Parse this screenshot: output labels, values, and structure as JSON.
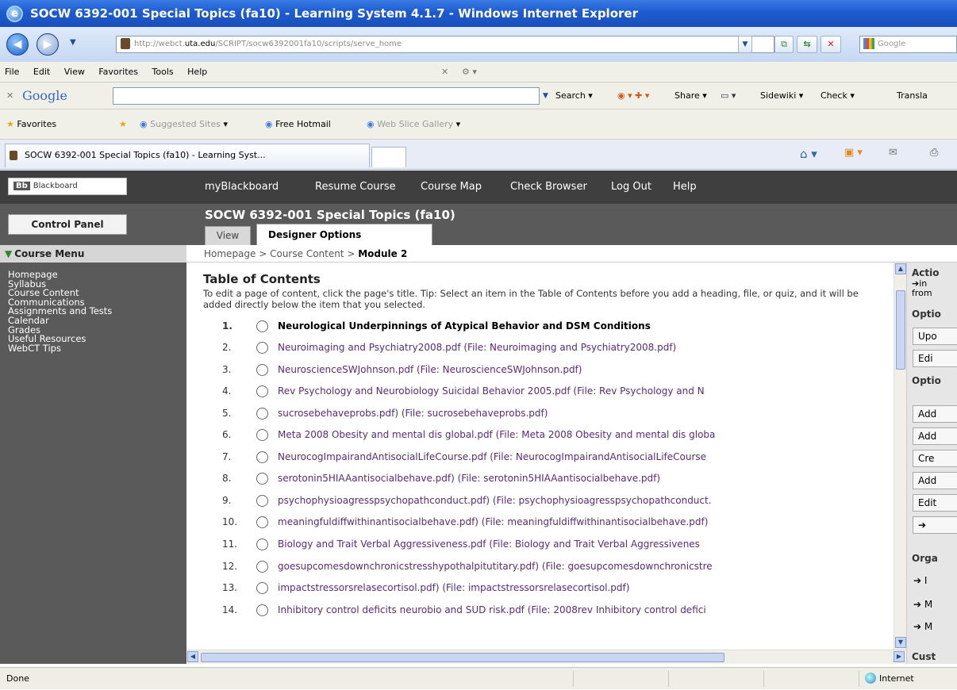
{
  "window": {
    "title": "SOCW 6392-001 Special Topics (fa10) - Learning System 4.1.7 - Windows Internet Explorer"
  },
  "address": {
    "host": "http://webct.",
    "domain": "uta.edu",
    "path": "/SCRIPT/socw6392001fa10/scripts/serve_home"
  },
  "search": {
    "placeholder": "Google"
  },
  "menu": [
    "File",
    "Edit",
    "View",
    "Favorites",
    "Tools",
    "Help"
  ],
  "google_toolbar": {
    "brand": "Google",
    "search": "Search",
    "share": "Share",
    "sidewiki": "Sidewiki",
    "check": "Check",
    "translate": "Transla"
  },
  "favorites_bar": {
    "favorites": "Favorites",
    "suggested": "Suggested Sites",
    "hotmail": "Free Hotmail",
    "webslice": "Web Slice Gallery"
  },
  "tab": {
    "label": "SOCW 6392-001 Special Topics (fa10) - Learning Syst..."
  },
  "bb": {
    "logo": "Blackboard",
    "nav": [
      "myBlackboard",
      "Resume Course",
      "Course Map",
      "Check Browser",
      "Log Out",
      "Help"
    ],
    "control_panel": "Control Panel",
    "course_title": "SOCW 6392-001 Special Topics (fa10)",
    "tab_view": "View",
    "tab_designer": "Designer Options",
    "course_menu": "Course Menu",
    "menu_items": [
      "Homepage",
      "Syllabus",
      "Course Content",
      "Communications",
      "Assignments and Tests",
      "Calendar",
      "Grades",
      "Useful Resources",
      "WebCT Tips"
    ]
  },
  "breadcrumb": {
    "home": "Homepage",
    "sep": " > ",
    "content": "Course Content",
    "current": "Module 2"
  },
  "toc": {
    "title": "Table of Contents",
    "description": "To edit a page of content, click the page's title. Tip: Select an item in the Table of Contents before you add a heading, file, or quiz, and it will be added directly below the item that you selected.",
    "items": [
      {
        "num": "1.",
        "text": "Neurological Underpinnings of Atypical Behavior and DSM Conditions"
      },
      {
        "num": "2.",
        "text": "Neuroimaging and Psychiatry2008.pdf  (File: Neuroimaging and Psychiatry2008.pdf)"
      },
      {
        "num": "3.",
        "text": "NeuroscienceSWJohnson.pdf  (File: NeuroscienceSWJohnson.pdf)"
      },
      {
        "num": "4.",
        "text": "Rev Psychology and Neurobiology Suicidal Behavior 2005.pdf  (File: Rev Psychology and N"
      },
      {
        "num": "5.",
        "text": "sucrosebehaveprobs.pdf)  (File: sucrosebehaveprobs.pdf)"
      },
      {
        "num": "6.",
        "text": "Meta 2008 Obesity and mental dis global.pdf  (File: Meta 2008 Obesity and mental dis globa"
      },
      {
        "num": "7.",
        "text": "NeurocogImpairandAntisocialLifeCourse.pdf  (File: NeurocogImpairandAntisocialLifeCourse"
      },
      {
        "num": "8.",
        "text": "serotonin5HIAAantisocialbehave.pdf)  (File: serotonin5HIAAantisocialbehave.pdf)"
      },
      {
        "num": "9.",
        "text": "psychophysioagresspsychopathconduct.pdf)  (File: psychophysioagresspsychopathconduct."
      },
      {
        "num": "10.",
        "text": "meaningfuldiffwithinantisocialbehave.pdf)  (File: meaningfuldiffwithinantisocialbehave.pdf)"
      },
      {
        "num": "11.",
        "text": "Biology and Trait Verbal Aggressiveness.pdf  (File: Biology and Trait Verbal Aggressivenes"
      },
      {
        "num": "12.",
        "text": "goesupcomesdownchronicstresshypothalpitutitary.pdf)  (File: goesupcomesdownchronicstre"
      },
      {
        "num": "13.",
        "text": "impactstressorsrelasecortisol.pdf)  (File: impactstressorsrelasecortisol.pdf)"
      },
      {
        "num": "14.",
        "text": "Inhibitory control deficits neurobio and SUD risk.pdf  (File: 2008rev Inhibitory control defici"
      }
    ]
  },
  "right_panel": {
    "actions_head": "Actio",
    "actions_sub1": "in",
    "actions_sub2": "from",
    "options1_head": "Optio",
    "options1_buttons": [
      "Upo",
      "Edi"
    ],
    "options2_head": "Optio",
    "options2_buttons": [
      "Add",
      "Add",
      "Cre",
      "Add",
      "Edit",
      ""
    ],
    "organize_head": "Orga",
    "organize_links": [
      "I",
      "M",
      "M"
    ],
    "custom_head": "Cust"
  },
  "status": {
    "text": "Done",
    "zone": "Internet"
  }
}
